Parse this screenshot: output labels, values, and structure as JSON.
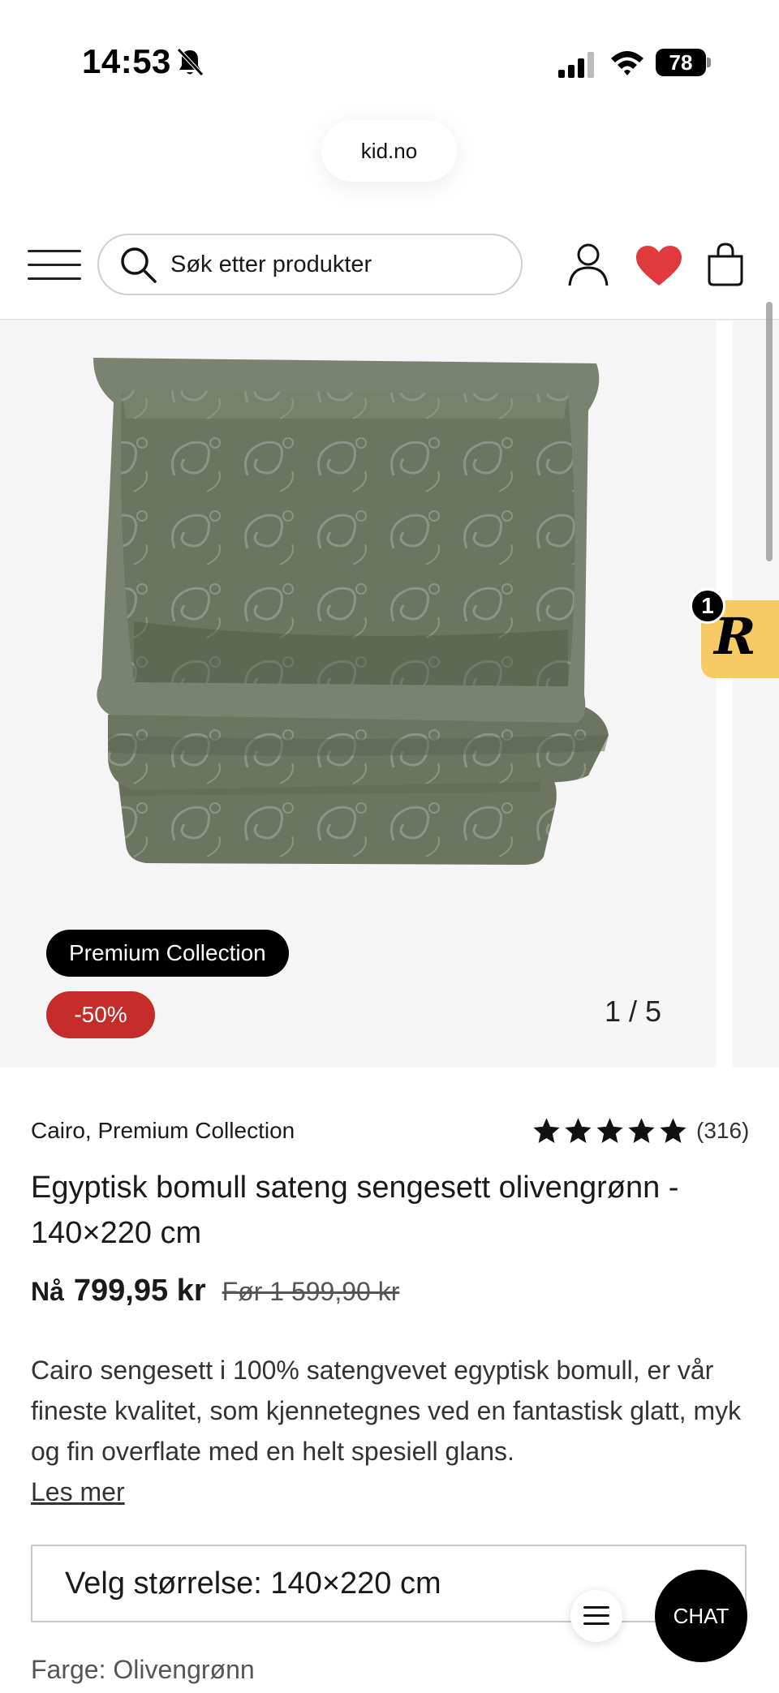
{
  "status_bar": {
    "time": "14:53",
    "battery": "78"
  },
  "browser": {
    "url": "kid.no"
  },
  "header": {
    "search_placeholder": "Søk etter produkter"
  },
  "colors": {
    "accent_red": "#c42c2a",
    "heart_red": "#e03a3e",
    "rewards_yellow": "#f6cb63"
  },
  "gallery": {
    "badge_collection": "Premium Collection",
    "badge_discount": "-50%",
    "counter": "1 / 5"
  },
  "rewards": {
    "count": "1",
    "logo": "R"
  },
  "product": {
    "brand": "Cairo, Premium Collection",
    "rating_stars": 5,
    "review_count": "(316)",
    "title": "Egyptisk bomull sateng sengesett olivengrønn - 140×220 cm",
    "price_now_label": "Nå",
    "price_now": "799,95 kr",
    "price_before": "Før 1 599,90 kr",
    "description": "Cairo sengesett i 100% satengvevet egyptisk bomull, er vår fineste kvalitet, som kjennetegnes ved en fantastisk glatt, myk og fin overflate med en helt spesiell glans.",
    "read_more": "Les mer",
    "size_select": "Velg størrelse: 140×220 cm",
    "color_label": "Farge:",
    "color_value": "Olivengrønn"
  },
  "floating": {
    "chat_label": "CHAT"
  }
}
